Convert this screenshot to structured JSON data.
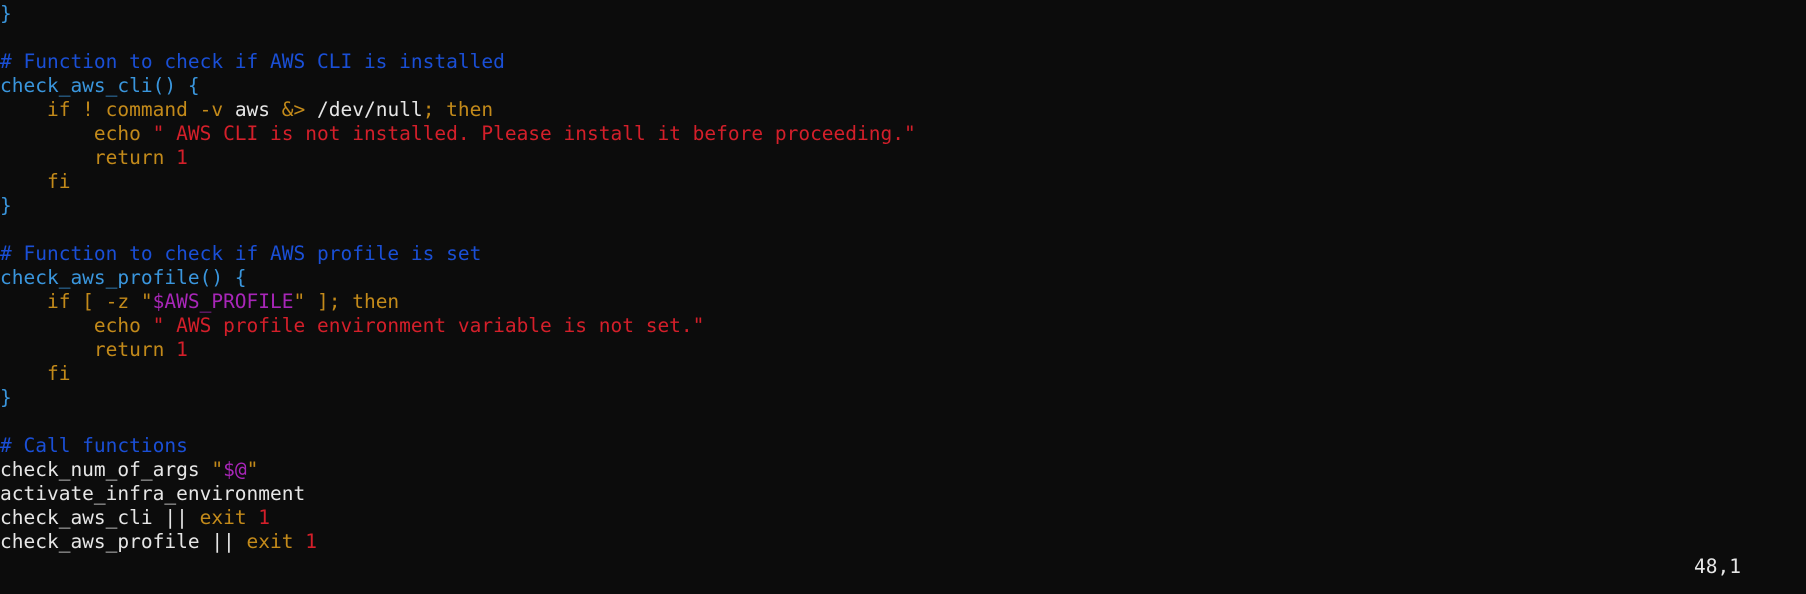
{
  "editor": {
    "lines": [
      [
        {
          "t": "}",
          "c": "blue"
        }
      ],
      [],
      [
        {
          "t": "# Function to check if AWS CLI is installed",
          "c": "comment"
        }
      ],
      [
        {
          "t": "check_aws_cli() {",
          "c": "blue"
        }
      ],
      [
        {
          "t": "    if ! command -v ",
          "c": "kw"
        },
        {
          "t": "aws ",
          "c": "white"
        },
        {
          "t": "&> ",
          "c": "kw"
        },
        {
          "t": "/dev/null",
          "c": "white"
        },
        {
          "t": "; then",
          "c": "kw"
        }
      ],
      [
        {
          "t": "        echo ",
          "c": "kw"
        },
        {
          "t": "\" AWS CLI is not installed. Please install it before proceeding.\"",
          "c": "red"
        }
      ],
      [
        {
          "t": "        return ",
          "c": "kw"
        },
        {
          "t": "1",
          "c": "red"
        }
      ],
      [
        {
          "t": "    fi",
          "c": "kw"
        }
      ],
      [
        {
          "t": "}",
          "c": "blue"
        }
      ],
      [],
      [
        {
          "t": "# Function to check if AWS profile is set",
          "c": "comment"
        }
      ],
      [
        {
          "t": "check_aws_profile() {",
          "c": "blue"
        }
      ],
      [
        {
          "t": "    if [ -z \"",
          "c": "kw"
        },
        {
          "t": "$AWS_PROFILE",
          "c": "purple"
        },
        {
          "t": "\" ]; then",
          "c": "kw"
        }
      ],
      [
        {
          "t": "        echo ",
          "c": "kw"
        },
        {
          "t": "\" AWS profile environment variable is not set.\"",
          "c": "red"
        }
      ],
      [
        {
          "t": "        return ",
          "c": "kw"
        },
        {
          "t": "1",
          "c": "red"
        }
      ],
      [
        {
          "t": "    fi",
          "c": "kw"
        }
      ],
      [
        {
          "t": "}",
          "c": "blue"
        }
      ],
      [],
      [
        {
          "t": "# Call functions",
          "c": "comment"
        }
      ],
      [
        {
          "t": "check_num_of_args ",
          "c": "white"
        },
        {
          "t": "\"",
          "c": "kw"
        },
        {
          "t": "$@",
          "c": "purple"
        },
        {
          "t": "\"",
          "c": "kw"
        }
      ],
      [
        {
          "t": "activate_infra_environment",
          "c": "white"
        }
      ],
      [
        {
          "t": "check_aws_cli || ",
          "c": "white"
        },
        {
          "t": "exit ",
          "c": "kw"
        },
        {
          "t": "1",
          "c": "red"
        }
      ],
      [
        {
          "t": "check_aws_profile || ",
          "c": "white"
        },
        {
          "t": "exit ",
          "c": "kw"
        },
        {
          "t": "1",
          "c": "red"
        }
      ]
    ]
  },
  "statusline": {
    "ruler": "48,1"
  },
  "colors": {
    "background": "#0c0c0c",
    "blue": "#3a96dd",
    "comment": "#1a4fd6",
    "keyword": "#c38a1a",
    "red": "#d41f2a",
    "purple": "#a826b8",
    "text": "#e6e6e6"
  }
}
